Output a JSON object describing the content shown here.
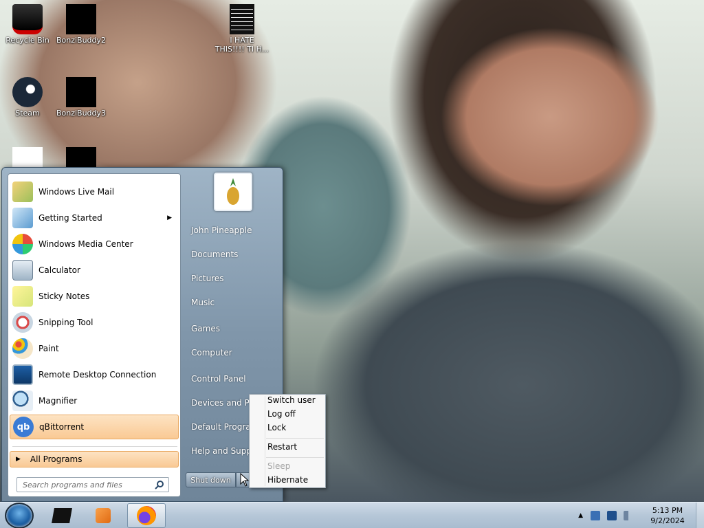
{
  "desktop": {
    "icons": [
      {
        "label": "Recycle Bin"
      },
      {
        "label": "BonziBuddy2"
      },
      {
        "label": "I HATE THIS!!!! TI H..."
      },
      {
        "label": "Steam"
      },
      {
        "label": "BonziBuddy3"
      }
    ]
  },
  "start_menu": {
    "programs": [
      {
        "label": "Windows Live Mail"
      },
      {
        "label": "Getting Started",
        "arrow": "▶"
      },
      {
        "label": "Windows Media Center"
      },
      {
        "label": "Calculator"
      },
      {
        "label": "Sticky Notes"
      },
      {
        "label": "Snipping Tool"
      },
      {
        "label": "Paint"
      },
      {
        "label": "Remote Desktop Connection"
      },
      {
        "label": "Magnifier"
      },
      {
        "label": "qBittorrent"
      }
    ],
    "all_programs": "All Programs",
    "search_placeholder": "Search programs and files",
    "right_items": [
      {
        "label": "John Pineapple"
      },
      {
        "label": "Documents"
      },
      {
        "label": "Pictures"
      },
      {
        "label": "Music"
      },
      {
        "label": "Games"
      },
      {
        "label": "Computer"
      },
      {
        "label": "Control Panel"
      },
      {
        "label": "Devices and Prin"
      },
      {
        "label": "Default Program"
      },
      {
        "label": "Help and Suppo"
      }
    ],
    "shutdown_label": "Shut down"
  },
  "power_menu": {
    "items": [
      "Switch user",
      "Log off",
      "Lock",
      "Restart",
      "Sleep",
      "Hibernate"
    ]
  },
  "taskbar": {
    "clock_time": "5:13 PM",
    "clock_date": "9/2/2024"
  },
  "colors": {
    "selected_item": "#f9c994",
    "start_menu_pane": "#8096aa",
    "taskbar": "#b6c7d8"
  }
}
